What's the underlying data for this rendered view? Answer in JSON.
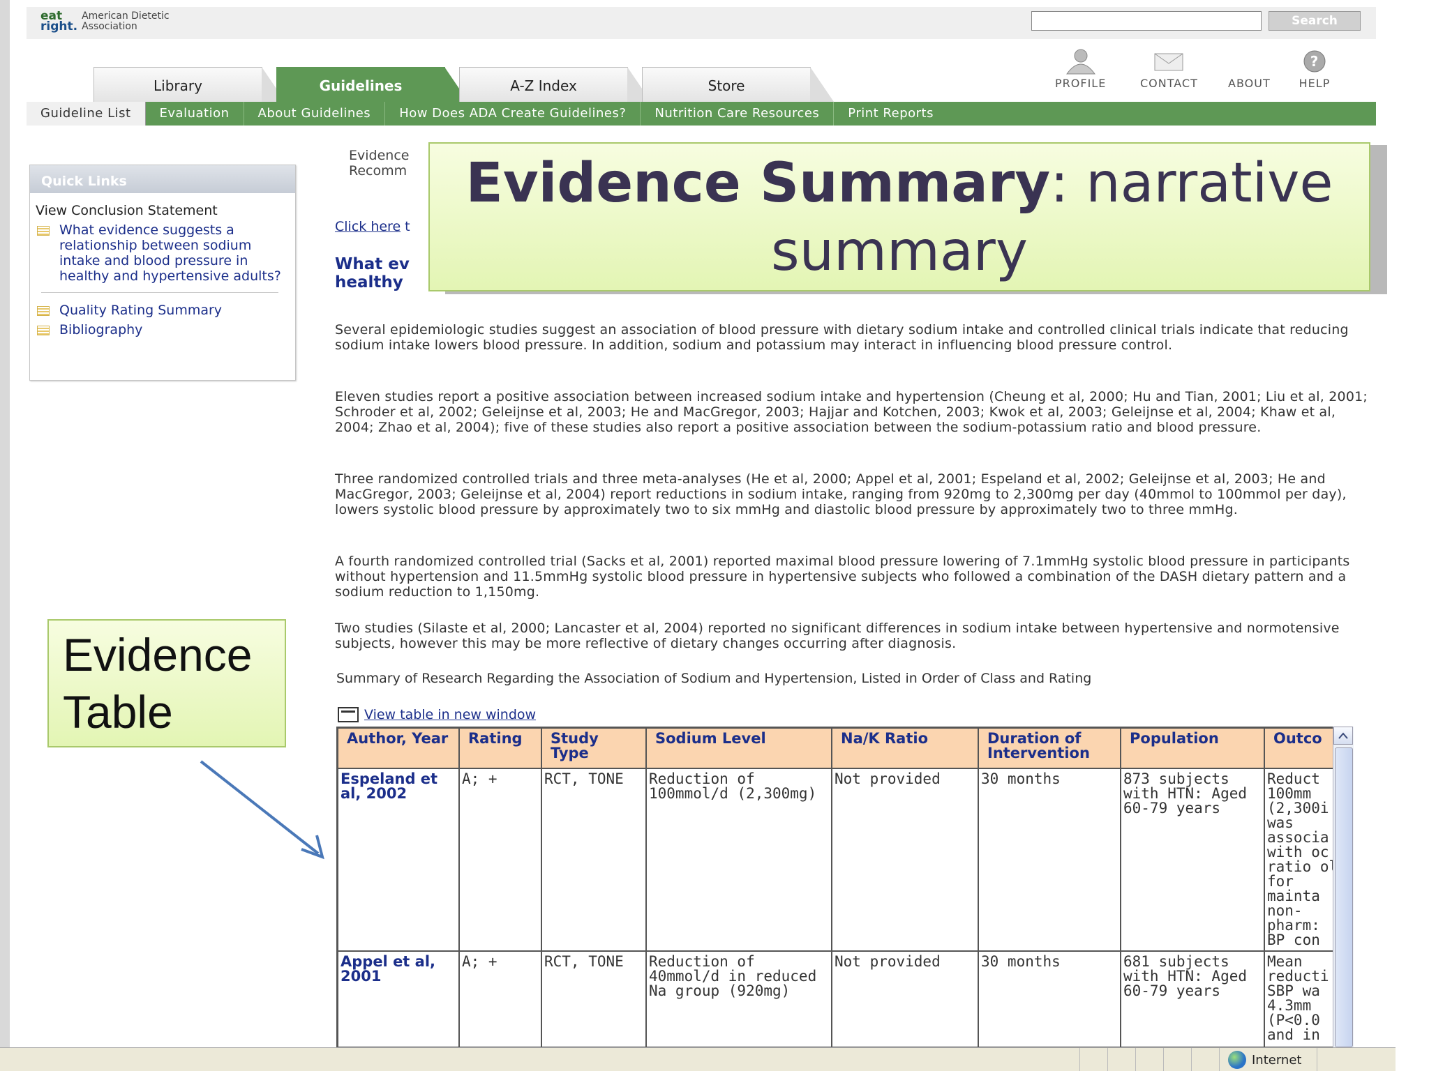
{
  "header": {
    "logo_mark_top": "eat",
    "logo_mark_bottom": "right.",
    "logo_text_line1": "American Dietetic",
    "logo_text_line2": "Association",
    "search_value": "",
    "search_button": "Search"
  },
  "tabs": [
    "Library",
    "Guidelines",
    "A-Z Index",
    "Store"
  ],
  "active_tab": "Guidelines",
  "utility": {
    "profile": "PROFILE",
    "contact": "CONTACT",
    "about": "ABOUT",
    "help": "HELP"
  },
  "nav": [
    "Guideline List",
    "Evaluation",
    "About Guidelines",
    "How Does ADA Create Guidelines?",
    "Nutrition Care Resources",
    "Print Reports"
  ],
  "quick_links": {
    "title": "Quick Links",
    "section_label": "View Conclusion Statement",
    "question_link": "What evidence suggests a relationship between sodium intake and blood pressure in healthy and hypertensive adults?",
    "links": [
      "Quality Rating Summary",
      "Bibliography"
    ]
  },
  "main": {
    "crumb_line1": "Evidence",
    "crumb_line2": "Recomm",
    "click_here": "Click here",
    "click_rest": " t",
    "question_line1": "What ev",
    "question_line2": "healthy",
    "callout_bold": "Evidence Summary",
    "callout_rest": ": narrative summary",
    "paragraphs": [
      "Several epidemiologic studies suggest an association of blood pressure with dietary sodium intake and controlled clinical trials indicate that reducing sodium intake lowers blood pressure. In addition, sodium and potassium may interact in influencing blood pressure control.",
      "Eleven studies report a positive association between increased sodium intake and hypertension (Cheung et al, 2000; Hu and Tian, 2001; Liu et al, 2001; Schroder et al, 2002; Geleijnse et al, 2003; He and MacGregor, 2003; Hajjar and Kotchen, 2003; Kwok et al, 2003; Geleijnse et al, 2004; Khaw et al, 2004; Zhao et al, 2004); five of these studies also report a positive association between the sodium-potassium ratio and blood pressure.",
      "Three randomized controlled trials and three meta-analyses (He et al, 2000; Appel et al, 2001; Espeland et al, 2002; Geleijnse et al, 2003; He and MacGregor, 2003; Geleijnse et al, 2004) report reductions in sodium intake, ranging from 920mg to 2,300mg per day (40mmol to 100mmol per day), lowers systolic blood pressure by approximately two to six mmHg and diastolic blood pressure by approximately two to three mmHg.",
      "A fourth randomized controlled trial (Sacks et al, 2001) reported maximal blood pressure lowering of 7.1mmHg systolic blood pressure in participants without hypertension and 11.5mmHg systolic blood pressure in hypertensive subjects who followed a combination of the DASH dietary pattern and a sodium reduction to 1,150mg.",
      "Two studies (Silaste et al, 2000; Lancaster et al, 2004) reported no significant differences in sodium intake between hypertensive and normotensive subjects, however this may be more reflective of dietary changes occurring after diagnosis."
    ],
    "table_title": "Summary of Research Regarding the Association of Sodium and Hypertension, Listed in Order of Class and Rating",
    "view_table_link": "View table in new window"
  },
  "table": {
    "headers": [
      "Author, Year",
      "Rating",
      "Study Type",
      "Sodium Level",
      "Na/K Ratio",
      "Duration of Intervention",
      "Population",
      "Outco"
    ],
    "rows": [
      {
        "author": "Espeland et al, 2002",
        "rating": "A; +",
        "type": "RCT, TONE",
        "sodium": "Reduction of 100mmol/d (2,300mg)",
        "nak": "Not provided",
        "duration": "30 months",
        "population": "873 subjects with HTN: Aged 60-79 years",
        "outcome": "Reduct 100mm (2,300i was associa with oc ratio ol for mainta non- pharm: BP con"
      },
      {
        "author": "Appel et al, 2001",
        "rating": "A; +",
        "type": "RCT, TONE",
        "sodium": "Reduction of 40mmol/d in reduced Na group (920mg)",
        "nak": "Not provided",
        "duration": "30 months",
        "population": "681 subjects with HTN: Aged 60-79 years",
        "outcome": "Mean reducti SBP wa 4.3mm (P<0.0 and in"
      }
    ]
  },
  "evidence_table_callout": "Evidence Table",
  "status": {
    "zone": "Internet"
  }
}
